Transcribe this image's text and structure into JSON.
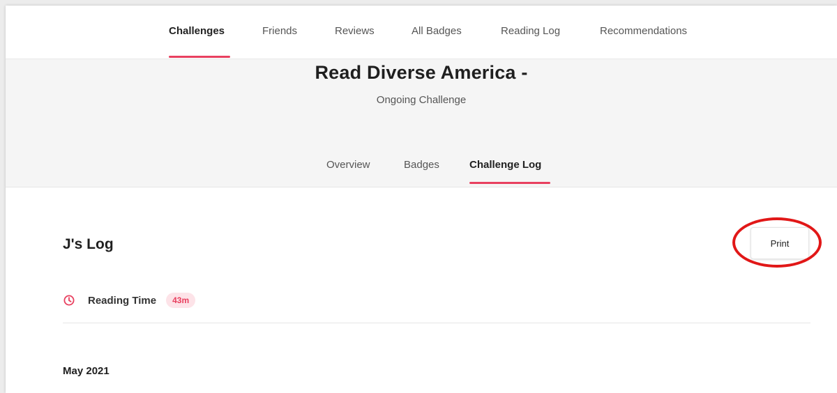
{
  "topnav": {
    "items": [
      {
        "label": "Challenges",
        "active": true
      },
      {
        "label": "Friends",
        "active": false
      },
      {
        "label": "Reviews",
        "active": false
      },
      {
        "label": "All Badges",
        "active": false
      },
      {
        "label": "Reading Log",
        "active": false
      },
      {
        "label": "Recommendations",
        "active": false
      }
    ]
  },
  "challenge": {
    "title": "Read Diverse America -",
    "subtitle": "Ongoing Challenge"
  },
  "subtabs": {
    "items": [
      {
        "label": "Overview",
        "active": false
      },
      {
        "label": "Badges",
        "active": false
      },
      {
        "label": "Challenge Log",
        "active": true
      }
    ]
  },
  "log": {
    "title": "J's Log",
    "print_label": "Print",
    "reading_time_label": "Reading Time",
    "reading_time_value": "43m",
    "reading_time_icon": "clock-icon",
    "month_heading": "May 2021"
  },
  "colors": {
    "accent": "#e8405f",
    "highlight_ring": "#e11717",
    "badge_bg": "#fde3e8"
  }
}
